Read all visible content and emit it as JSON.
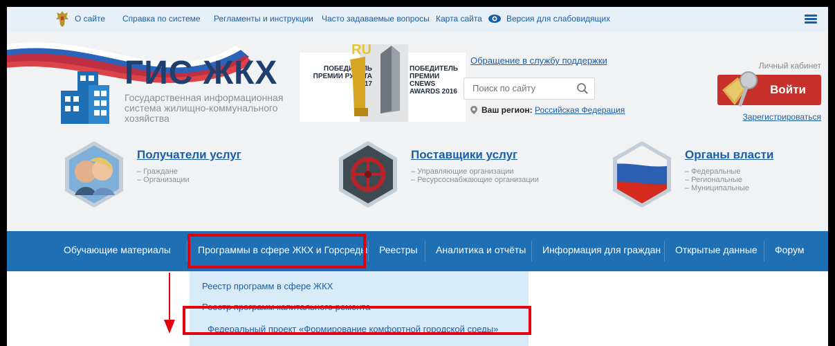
{
  "topbar": {
    "links": [
      "О сайте",
      "Справка по системе",
      "Регламенты и инструкции",
      "Часто задаваемые вопросы",
      "Карта сайта",
      "Версия для слабовидящих"
    ]
  },
  "logo": {
    "title": "ГИС ЖКХ",
    "subtitle": "Государственная информационная система жилищно-коммунального хозяйства"
  },
  "awards": {
    "runet": "ПОБЕДИТЕЛЬ ПРЕМИИ РУНЕТА 2017",
    "cnews": "ПОБЕДИТЕЛЬ ПРЕМИИ CNEWS AWARDS 2016",
    "ru_badge": "RU"
  },
  "header": {
    "support_link": "Обращение в службу поддержки",
    "search_placeholder": "Поиск по сайту",
    "region_label": "Ваш регион:",
    "region_value": "Российская Федерация",
    "cabinet_label": "Личный кабинет",
    "login_label": "Войти",
    "register_link": "Зарегистрироваться"
  },
  "categories": [
    {
      "title": "Получатели услуг",
      "items": [
        "– Граждане",
        "– Организации"
      ]
    },
    {
      "title": "Поставщики услуг",
      "items": [
        "– Управляющие организации",
        "– Ресурсоснабжающие организации"
      ]
    },
    {
      "title": "Органы власти",
      "items": [
        "– Федеральные",
        "– Региональные",
        "– Муниципальные"
      ]
    }
  ],
  "nav": {
    "items": [
      "Обучающие материалы",
      "Программы в сфере ЖКХ и Горсреды",
      "Реестры",
      "Аналитика и отчёты",
      "Информация для граждан",
      "Открытые данные",
      "Форум"
    ]
  },
  "dropdown": {
    "items": [
      "Реестр программ в сфере ЖКХ",
      "Реестр программ капитального ремонта",
      "Федеральный проект «Формирование комфортной городской среды»"
    ]
  },
  "colors": {
    "nav_bg": "#1e6fb3",
    "link": "#1a5ea9",
    "login_bg": "#c8302b",
    "highlight": "#e3000f",
    "dropdown_bg": "#d8ebf9"
  }
}
